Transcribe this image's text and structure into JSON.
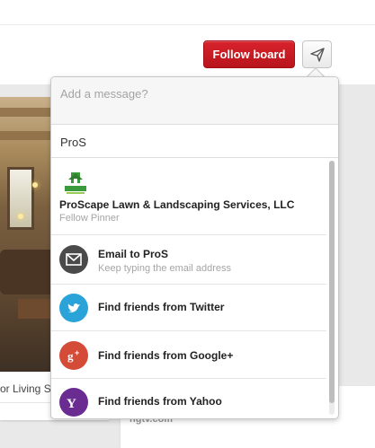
{
  "header": {
    "follow_label": "Follow board",
    "send_icon": "paper-plane-icon"
  },
  "pin": {
    "caption": "or Living S"
  },
  "right_card": {
    "source": "hgtv.com"
  },
  "share_popup": {
    "message_placeholder": "Add a message?",
    "search_value": "ProS",
    "results": {
      "pinner": {
        "logo_text": "PROSCAPE",
        "name": "ProScape Lawn & Landscaping Services, LLC",
        "role": "Fellow Pinner"
      },
      "email": {
        "icon": "envelope-icon",
        "title": "Email to ProS",
        "hint": "Keep typing the email address"
      },
      "twitter": {
        "icon": "twitter-bird-icon",
        "label": "Find friends from Twitter",
        "color": "#2aa3d8"
      },
      "google": {
        "icon": "google-plus-icon",
        "label": "Find friends from Google+",
        "color": "#d44b38"
      },
      "yahoo": {
        "icon": "yahoo-icon",
        "label": "Find friends from Yahoo",
        "color": "#6b2c91"
      }
    }
  }
}
